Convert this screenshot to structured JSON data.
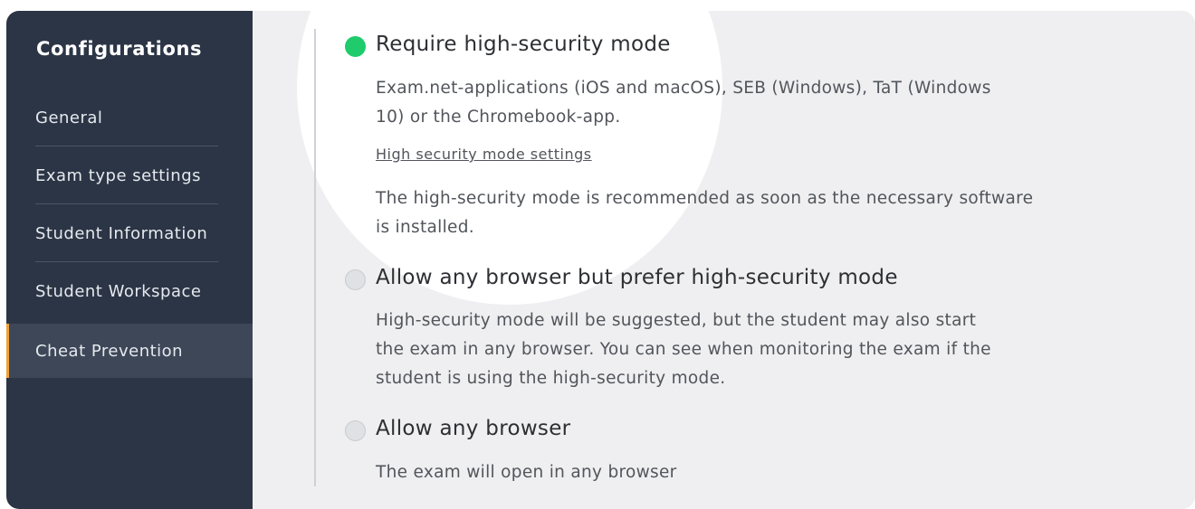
{
  "sidebar": {
    "title": "Configurations",
    "items": [
      {
        "label": "General"
      },
      {
        "label": "Exam type settings"
      },
      {
        "label": "Student Information"
      },
      {
        "label": "Student Workspace"
      },
      {
        "label": "Cheat Prevention"
      }
    ],
    "active_index": 4
  },
  "options": [
    {
      "title": "Require high-security mode",
      "selected": true,
      "desc": "Exam.net-applications (iOS and macOS), SEB (Windows), TaT (Windows 10) or the Chromebook-app.",
      "link": "High security mode settings",
      "note": "The high-security mode is recommended as soon as the necessary software is installed."
    },
    {
      "title": "Allow any browser but prefer high-security mode",
      "selected": false,
      "desc": "High-security mode will be suggested, but the student may also start the exam in any browser. You can see when monitoring the exam if the student is using the high-security mode."
    },
    {
      "title": "Allow any browser",
      "selected": false,
      "desc": "The exam will open in any browser"
    }
  ],
  "colors": {
    "sidebar_bg": "#2b3545",
    "active_accent": "#f0a13a",
    "radio_selected": "#1fcb6a"
  }
}
